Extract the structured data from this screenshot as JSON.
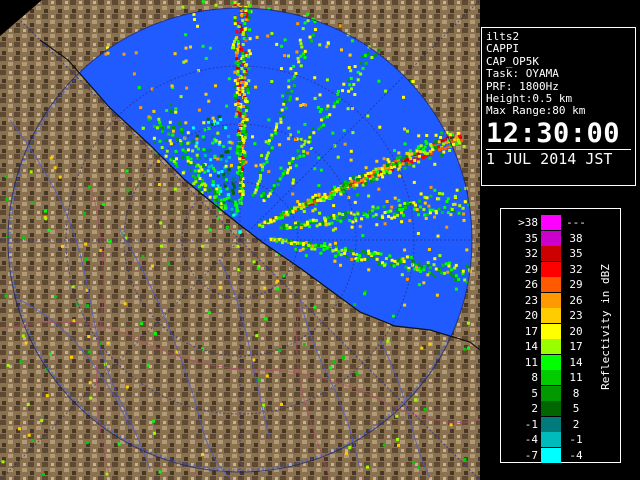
{
  "info": {
    "station": "ilts2",
    "product": "CAPPI",
    "product_id": "CAP_OP5K",
    "task": "Task: OYAMA",
    "prf": "PRF: 1800Hz",
    "height": "Height:0.5 km",
    "max_range": "Max Range:80 km",
    "time": "12:30:00",
    "date": "1 JUL 2014 JST"
  },
  "legend": {
    "title": "Reflectivity in dBZ",
    "rows": [
      {
        "lo": ">38",
        "hi": "---",
        "color": "#ff00ff"
      },
      {
        "lo": "35",
        "hi": "38",
        "color": "#cc00cc"
      },
      {
        "lo": "32",
        "hi": "35",
        "color": "#cc0000"
      },
      {
        "lo": "29",
        "hi": "32",
        "color": "#ff0000"
      },
      {
        "lo": "26",
        "hi": "29",
        "color": "#ff5a00"
      },
      {
        "lo": "23",
        "hi": "26",
        "color": "#ff9900"
      },
      {
        "lo": "20",
        "hi": "23",
        "color": "#ffcc00"
      },
      {
        "lo": "17",
        "hi": "20",
        "color": "#ffff00"
      },
      {
        "lo": "14",
        "hi": "17",
        "color": "#99ff00"
      },
      {
        "lo": "11",
        "hi": "14",
        "color": "#00ff00"
      },
      {
        "lo": "8",
        "hi": "11",
        "color": "#00cc00"
      },
      {
        "lo": "5",
        "hi": "8",
        "color": "#009900"
      },
      {
        "lo": "2",
        "hi": "5",
        "color": "#006600"
      },
      {
        "lo": "-1",
        "hi": "2",
        "color": "#007a7a"
      },
      {
        "lo": "-4",
        "hi": "-1",
        "color": "#00bbbb"
      },
      {
        "lo": "-7",
        "hi": "-4",
        "color": "#00ffff"
      }
    ]
  },
  "colors": {
    "sea_scan": "#1f5bff",
    "land": "#8a7150",
    "background": "#000000"
  }
}
